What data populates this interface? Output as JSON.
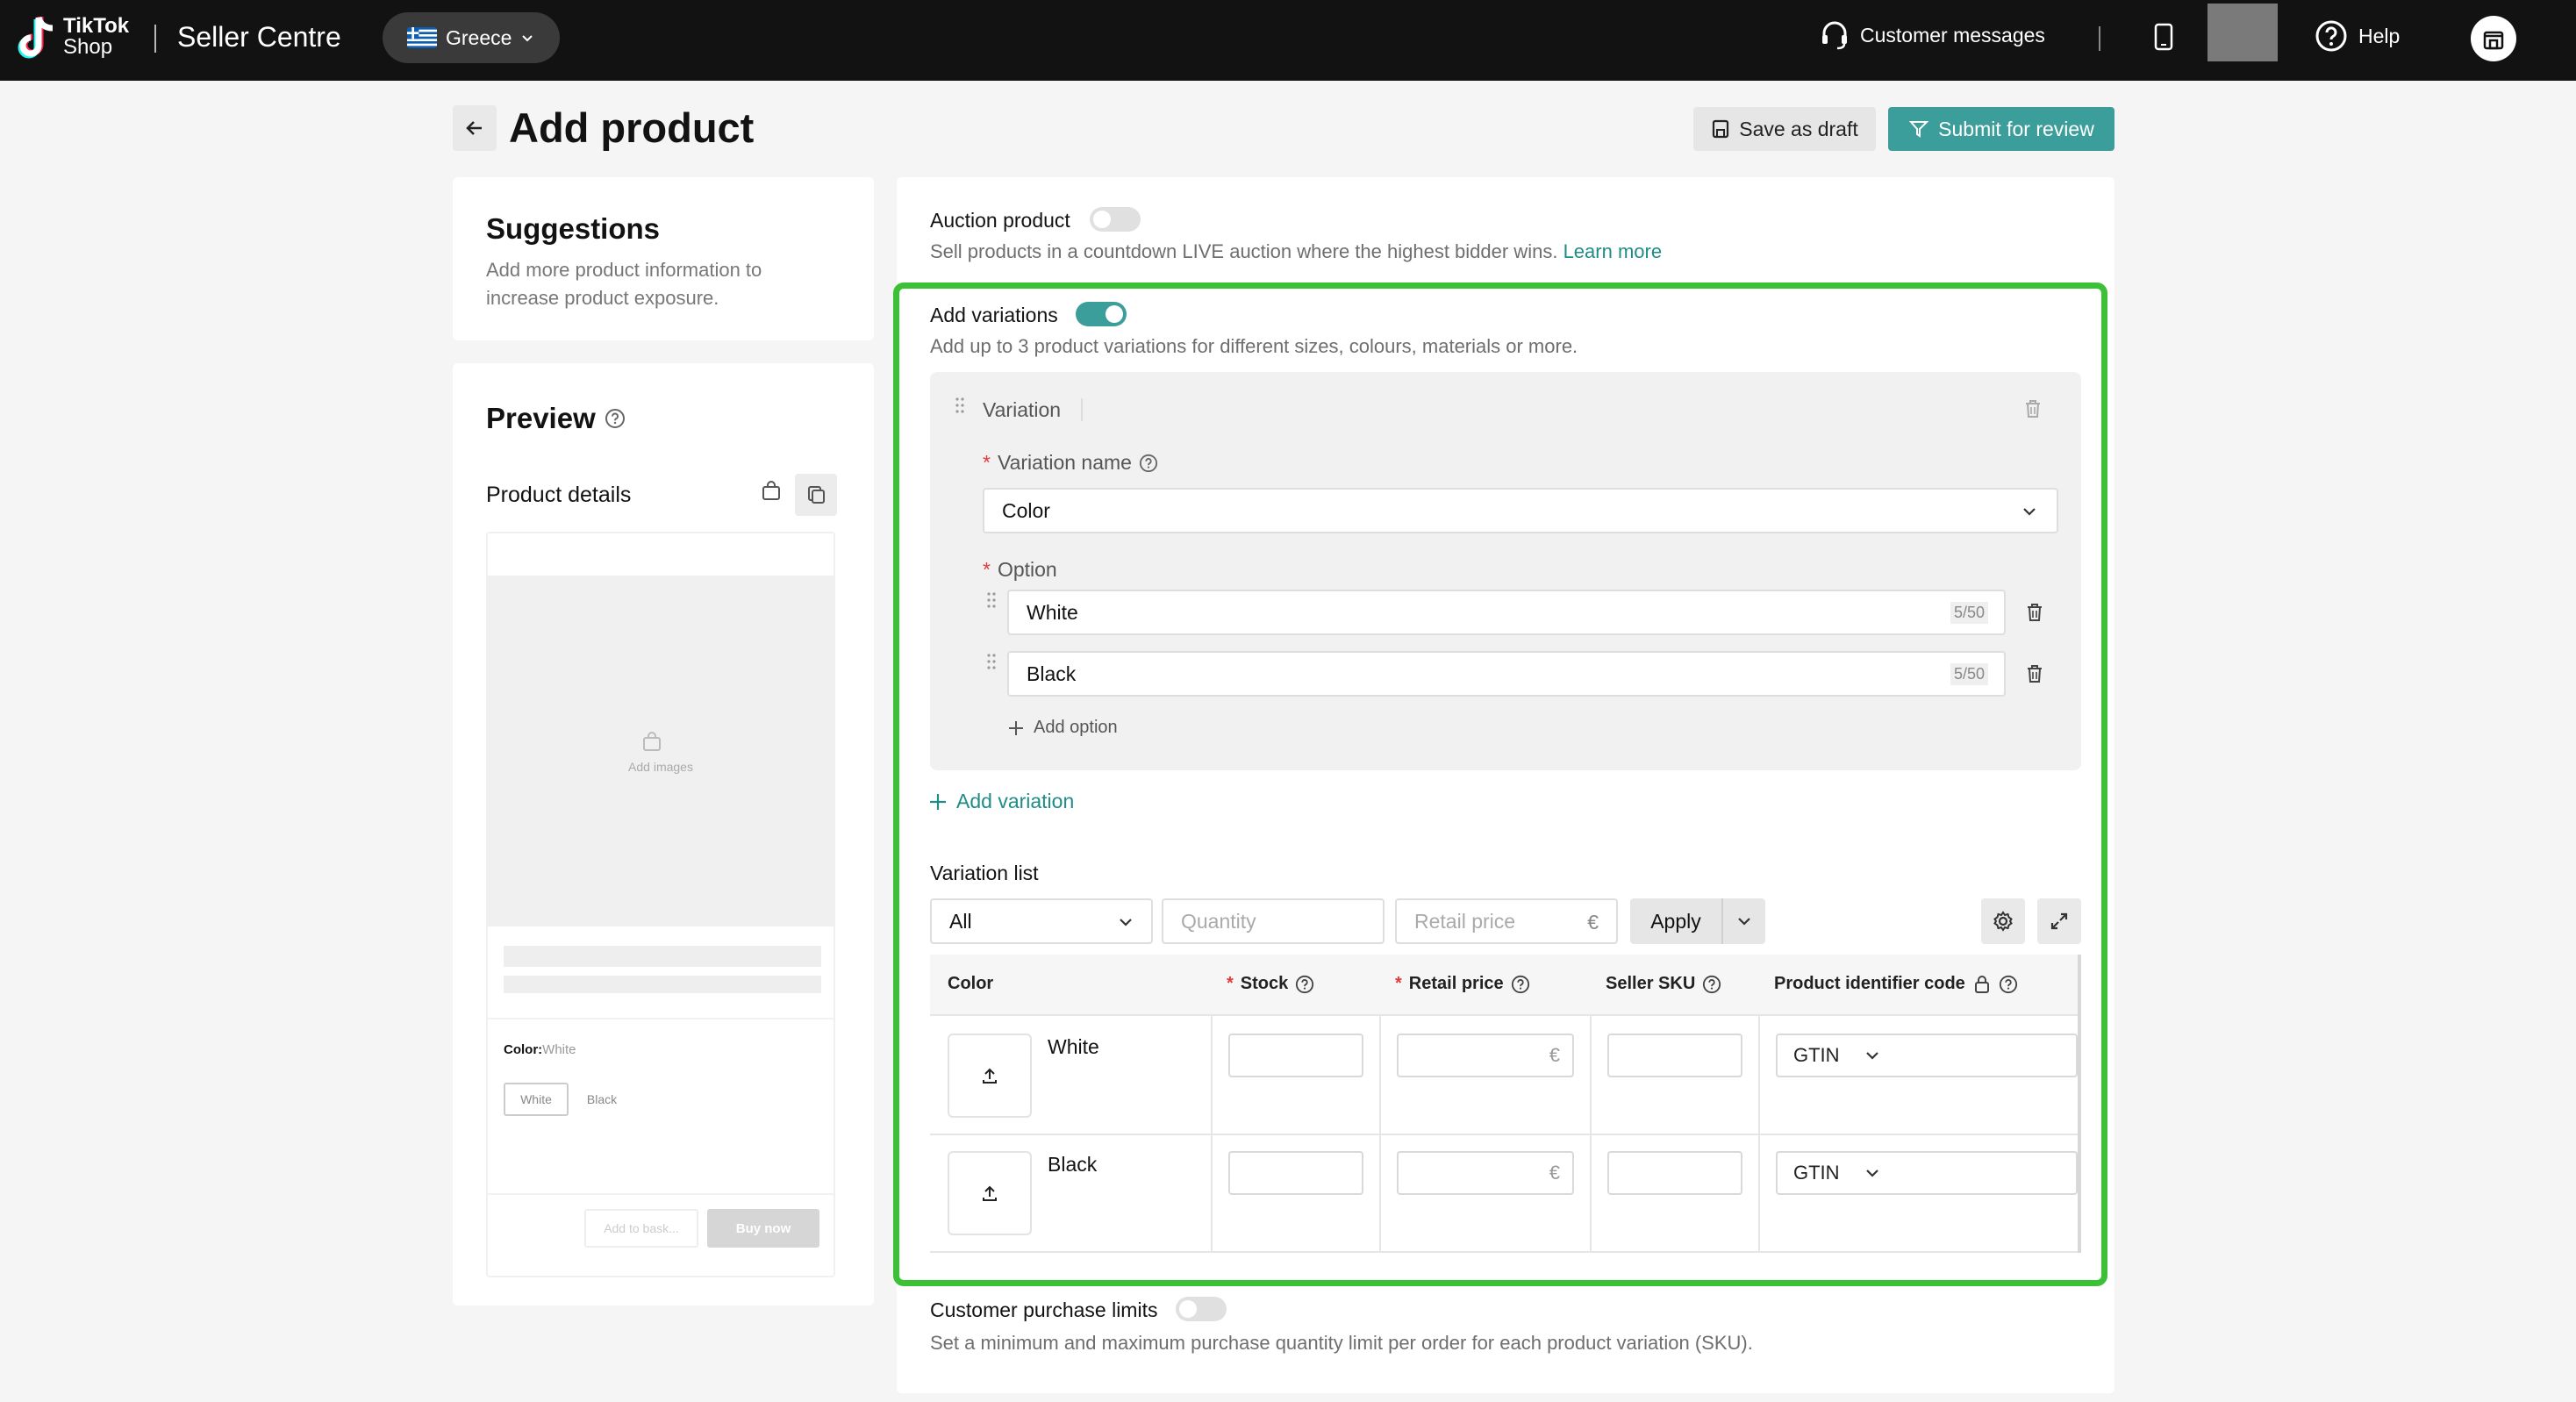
{
  "topbar": {
    "logo_line1": "TikTok",
    "logo_line2": "Shop",
    "product": "Seller Centre",
    "region": "Greece",
    "customer_messages": "Customer messages",
    "help": "Help"
  },
  "header": {
    "title": "Add product",
    "save_draft": "Save as draft",
    "submit": "Submit for review"
  },
  "suggestions": {
    "title": "Suggestions",
    "desc_line1": "Add more product information to",
    "desc_line2": "increase product exposure."
  },
  "preview": {
    "title": "Preview",
    "product_details": "Product details",
    "add_images": "Add images",
    "color_label": "Color:",
    "color_value": "White",
    "chip_white": "White",
    "chip_black": "Black",
    "add_to_basket": "Add to bask...",
    "buy_now": "Buy now"
  },
  "auction": {
    "label": "Auction product",
    "enabled": false,
    "desc": "Sell products in a countdown LIVE auction where the highest bidder wins.",
    "learn_more": "Learn more"
  },
  "variations": {
    "label": "Add variations",
    "enabled": true,
    "desc": "Add up to 3 product variations for different sizes, colours, materials or more.",
    "block_title": "Variation",
    "name_label": "Variation name",
    "name_value": "Color",
    "option_label": "Option",
    "options": [
      {
        "value": "White",
        "counter": "5/50"
      },
      {
        "value": "Black",
        "counter": "5/50"
      }
    ],
    "add_option": "Add option",
    "add_variation": "Add variation"
  },
  "variation_list": {
    "title": "Variation list",
    "filter_value": "All",
    "quantity_placeholder": "Quantity",
    "price_placeholder": "Retail price",
    "currency": "€",
    "apply": "Apply",
    "columns": {
      "color": "Color",
      "stock": "Stock",
      "retail_price": "Retail price",
      "seller_sku": "Seller SKU",
      "identifier": "Product identifier code"
    },
    "rows": [
      {
        "color": "White",
        "price_currency": "€",
        "id_type": "GTIN"
      },
      {
        "color": "Black",
        "price_currency": "€",
        "id_type": "GTIN"
      }
    ]
  },
  "purchase_limits": {
    "label": "Customer purchase limits",
    "enabled": false,
    "desc": "Set a minimum and maximum purchase quantity limit per order for each product variation (SKU)."
  },
  "colors": {
    "accent": "#3b9e9a",
    "highlight": "#3cc035",
    "topbar": "#121212"
  }
}
